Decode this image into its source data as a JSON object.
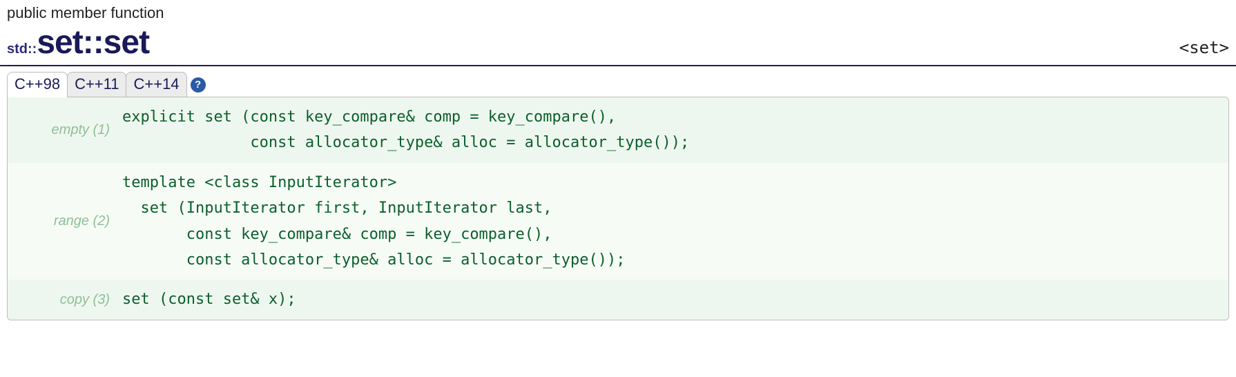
{
  "kind": "public member function",
  "title": {
    "namespace_prefix": "std::",
    "class_name": "set",
    "separator": "::",
    "member_name": "set"
  },
  "header_include": "<set>",
  "tabs": [
    "C++98",
    "C++11",
    "C++14"
  ],
  "active_tab_index": 0,
  "help_tooltip": "?",
  "declarations": [
    {
      "label": "empty (1)",
      "code": "explicit set (const key_compare& comp = key_compare(),\n              const allocator_type& alloc = allocator_type());"
    },
    {
      "label": "range (2)",
      "code": "template <class InputIterator>\n  set (InputIterator first, InputIterator last,\n       const key_compare& comp = key_compare(),\n       const allocator_type& alloc = allocator_type());"
    },
    {
      "label": "copy (3)",
      "code": "set (const set& x);"
    }
  ]
}
